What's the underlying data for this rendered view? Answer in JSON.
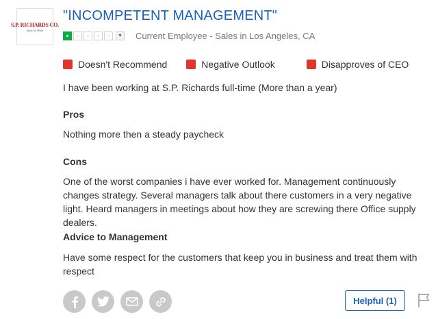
{
  "employer": {
    "logo_text": "S.P. RICHARDS CO.",
    "logo_subtext": "Ideas for Work"
  },
  "review": {
    "title": "\"INCOMPETENT MANAGEMENT\"",
    "rating": 1,
    "rating_max": 5,
    "employee_info": "Current Employee - Sales in Los Angeles, CA",
    "badges": [
      {
        "label": "Doesn't Recommend",
        "color": "#e0352b"
      },
      {
        "label": "Negative Outlook",
        "color": "#e0352b"
      },
      {
        "label": "Disapproves of CEO",
        "color": "#e0352b"
      }
    ],
    "employment": "I have been working at S.P. Richards full-time (More than a year)",
    "pros_heading": "Pros",
    "pros_text": "Nothing more then a steady paycheck",
    "cons_heading": "Cons",
    "cons_text": "One of the worst companies i have ever worked for. Management continuously changes strategy. Several managers talk about there customers in a very negative light. Heard managers in meetings about how they are screwing there Office supply dealers.",
    "advice_heading": "Advice to Management",
    "advice_text": "Have some respect for the customers that keep you in business and treat them with respect"
  },
  "actions": {
    "share_icons": [
      "facebook-icon",
      "twitter-icon",
      "email-icon",
      "link-icon"
    ],
    "helpful_label": "Helpful (1)",
    "flag_icon": "flag-icon"
  },
  "colors": {
    "title": "#1861bf",
    "star_filled": "#0caa41",
    "negative": "#e0352b"
  }
}
